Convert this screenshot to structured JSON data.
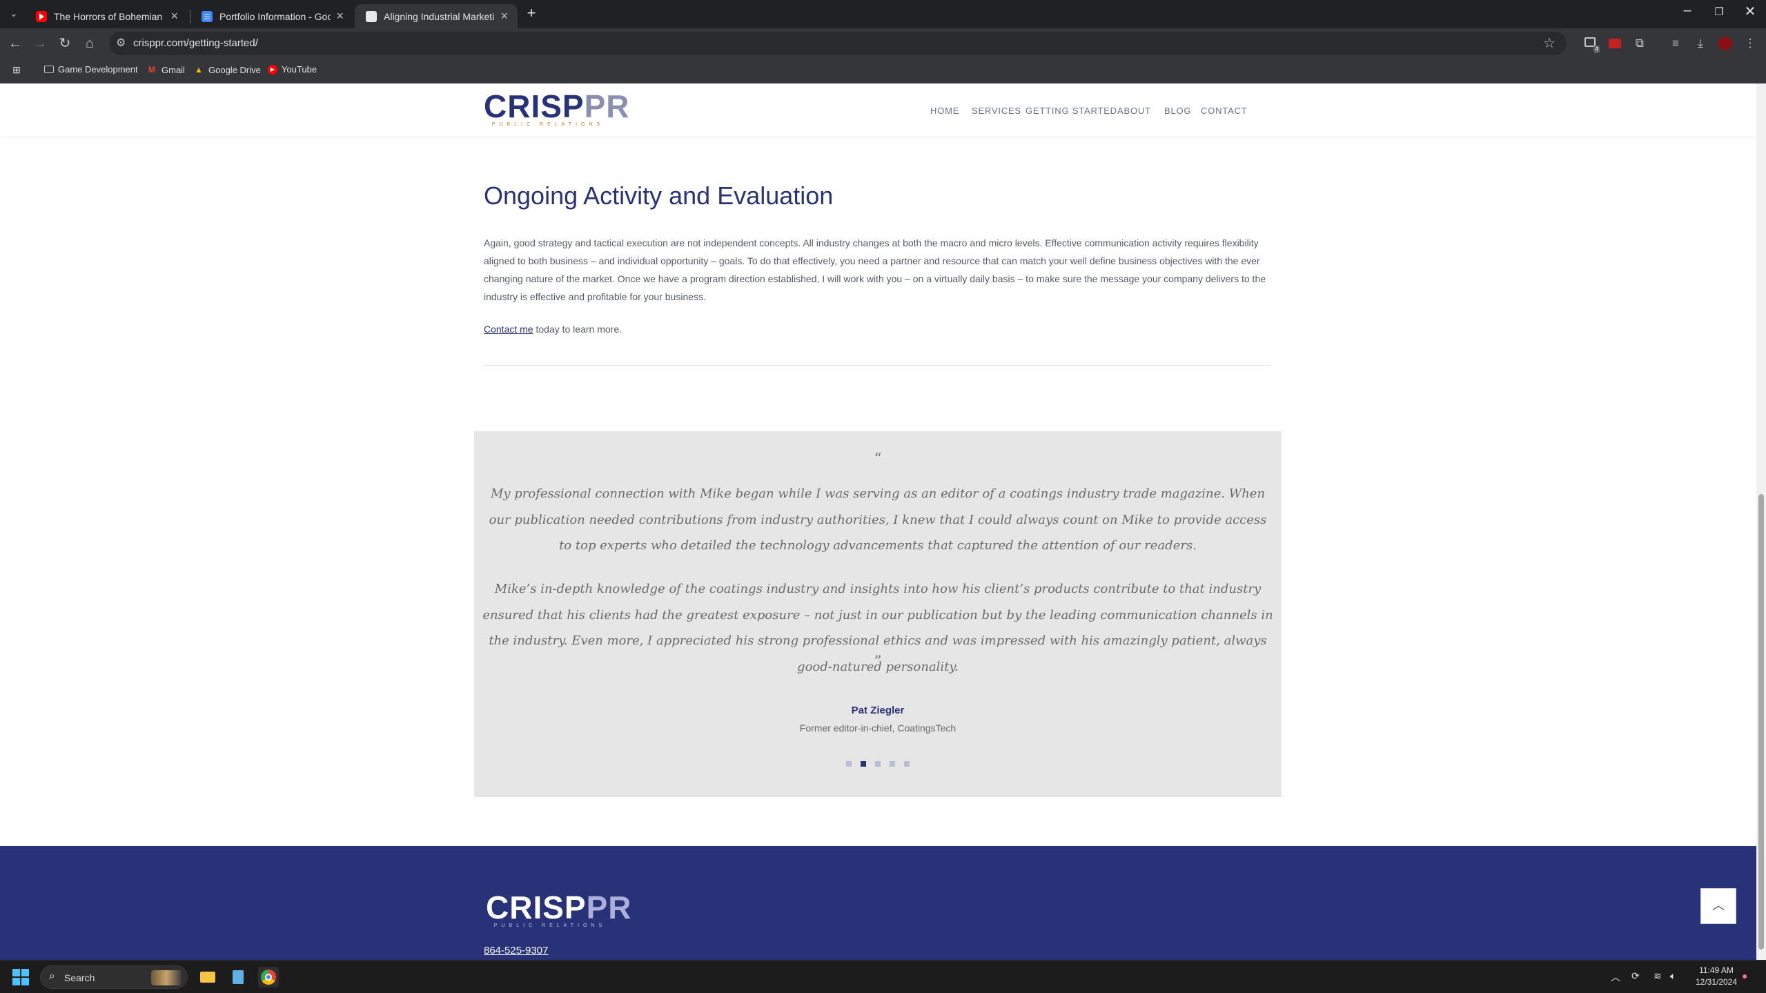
{
  "browser": {
    "tabs": [
      {
        "title": "The Horrors of Bohemian Grov",
        "favicon": "youtube-icon",
        "active": false
      },
      {
        "title": "Portfolio Information - Google",
        "favicon": "google-docs-icon",
        "active": false
      },
      {
        "title": "Aligning Industrial Marketing G",
        "favicon": "page-icon",
        "active": true
      }
    ],
    "new_tab_label": "+",
    "url": "crisppr.com/getting-started/",
    "bookmarks": [
      {
        "label": "Game Development",
        "icon": "folder-icon"
      },
      {
        "label": "Gmail",
        "icon": "gmail-icon"
      },
      {
        "label": "Google Drive",
        "icon": "google-drive-icon"
      },
      {
        "label": "YouTube",
        "icon": "youtube-icon"
      }
    ],
    "extension_badge": "4"
  },
  "site": {
    "logo_text": "CRISPPR",
    "logo_crisp": "CRISP",
    "logo_pr": "PR",
    "logo_subtitle": "PUBLIC RELATIONS",
    "nav": [
      "HOME",
      "SERVICES",
      "GETTING STARTED",
      "ABOUT",
      "BLOG",
      "CONTACT"
    ],
    "colors": {
      "brand_navy": "#283278",
      "logo_orange": "#e07b2a",
      "testimonial_bg": "#e6e6e6"
    }
  },
  "main": {
    "heading": "Ongoing Activity and Evaluation",
    "paragraph": "Again, good strategy and tactical execution are not independent concepts.  All industry changes at both the macro and micro levels. Effective communication activity requires flexibility aligned to both business – and individual opportunity – goals. To do that effectively, you need a partner and resource that can match your well define business objectives with the ever changing nature of the market.  Once we have a program direction established, I will work with you – on a virtually daily basis – to make sure the message your company delivers to the industry is effective and profitable for your business.",
    "contact_link": "Contact me",
    "contact_rest": " today to learn more."
  },
  "testimonial": {
    "open_quote": "“",
    "close_quote": "”",
    "paragraph1": "My professional connection with Mike began while I was serving as an editor of a coatings industry trade magazine. When our publication needed contributions from industry authorities, I knew that I could always count on Mike to provide access to top experts who detailed the technology advancements that captured the attention of our readers.",
    "paragraph2": "Mike’s in-depth knowledge of the coatings industry and insights into how his client’s products contribute to that industry ensured that his clients had the greatest exposure – not just in our publication but by the leading communication channels in the industry. Even more, I appreciated his strong professional ethics and was impressed with his amazingly patient, always good-natured personality.",
    "author": "Pat Ziegler",
    "role": "Former editor-in-chief, CoatingsTech",
    "slide_count": 5,
    "active_slide": 2
  },
  "footer": {
    "phone": "864-525-9307"
  },
  "taskbar": {
    "search_label": "Search",
    "time": "11:49 AM",
    "date": "12/31/2024"
  }
}
